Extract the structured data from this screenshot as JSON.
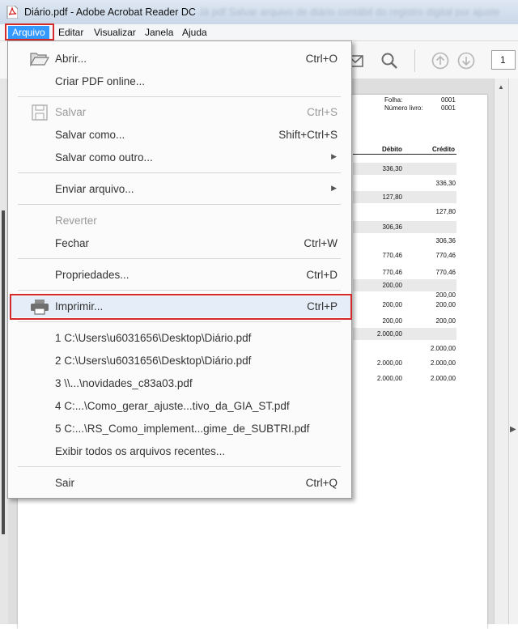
{
  "window": {
    "title": "Diário.pdf - Adobe Acrobat Reader DC",
    "ghost_title": "Já pdf Salvar arquivo de diário contábil do registro digital por ajuste"
  },
  "menubar": {
    "items": [
      {
        "label": "Arquivo",
        "active": true
      },
      {
        "label": "Editar"
      },
      {
        "label": "Visualizar"
      },
      {
        "label": "Janela"
      },
      {
        "label": "Ajuda"
      }
    ]
  },
  "toolbar": {
    "page_number": "1",
    "icons": [
      "mail-icon",
      "search-icon",
      "page-up-icon",
      "page-down-icon"
    ]
  },
  "file_menu": {
    "items": [
      {
        "key": "abrir",
        "label": "Abrir...",
        "shortcut": "Ctrl+O",
        "icon": "folder-open-icon",
        "enabled": true
      },
      {
        "key": "criar",
        "label": "Criar PDF online...",
        "shortcut": "",
        "enabled": true
      },
      {
        "key": "salvar",
        "label": "Salvar",
        "shortcut": "Ctrl+S",
        "icon": "save-icon",
        "enabled": false
      },
      {
        "key": "salvar_como",
        "label": "Salvar como...",
        "shortcut": "Shift+Ctrl+S",
        "enabled": true
      },
      {
        "key": "salvar_outro",
        "label": "Salvar como outro...",
        "shortcut": "",
        "submenu": true,
        "enabled": true
      },
      {
        "key": "enviar",
        "label": "Enviar arquivo...",
        "shortcut": "",
        "submenu": true,
        "enabled": true
      },
      {
        "key": "reverter",
        "label": "Reverter",
        "shortcut": "",
        "enabled": false
      },
      {
        "key": "fechar",
        "label": "Fechar",
        "shortcut": "Ctrl+W",
        "enabled": true
      },
      {
        "key": "propriedades",
        "label": "Propriedades...",
        "shortcut": "Ctrl+D",
        "enabled": true
      },
      {
        "key": "imprimir",
        "label": "Imprimir...",
        "shortcut": "Ctrl+P",
        "icon": "printer-icon",
        "enabled": true,
        "highlighted": true
      },
      {
        "key": "recent1",
        "label": "1 C:\\Users\\u6031656\\Desktop\\Diário.pdf"
      },
      {
        "key": "recent2",
        "label": "2 C:\\Users\\u6031656\\Desktop\\Diário.pdf"
      },
      {
        "key": "recent3",
        "label": "3 \\\\...\\novidades_c83a03.pdf"
      },
      {
        "key": "recent4",
        "label": "4 C:...\\Como_gerar_ajuste...tivo_da_GIA_ST.pdf"
      },
      {
        "key": "recent5",
        "label": "5 C:...\\RS_Como_implement...gime_de_SUBTRI.pdf"
      },
      {
        "key": "exibir",
        "label": "Exibir todos os arquivos recentes..."
      },
      {
        "key": "sair",
        "label": "Sair",
        "shortcut": "Ctrl+Q",
        "enabled": true
      }
    ]
  },
  "document": {
    "folha_label": "Folha:",
    "folha_value": "0001",
    "livro_label": "Número livro:",
    "livro_value": "0001",
    "col_debito": "Débito",
    "col_credito": "Crédito",
    "rows": [
      {
        "debito": "336,30",
        "credito": "",
        "shade": true
      },
      {
        "debito": "",
        "credito": "336,30",
        "shade": false
      },
      {
        "debito": "127,80",
        "credito": "",
        "shade": true
      },
      {
        "debito": "",
        "credito": "127,80",
        "shade": false
      },
      {
        "debito": "306,36",
        "credito": "",
        "shade": true
      },
      {
        "debito": "",
        "credito": "306,36",
        "shade": false
      },
      {
        "debito": "770,46",
        "credito": "770,46",
        "shade": false
      },
      {
        "debito": "770,46",
        "credito": "770,46",
        "shade": false
      },
      {
        "debito": "200,00",
        "credito": "",
        "shade": true
      },
      {
        "debito": "",
        "credito": "200,00",
        "shade": false
      },
      {
        "debito": "200,00",
        "credito": "200,00",
        "shade": false
      },
      {
        "debito": "200,00",
        "credito": "200,00",
        "shade": false
      },
      {
        "debito": "2.000,00",
        "credito": "",
        "shade": true
      },
      {
        "debito": "",
        "credito": "2.000,00",
        "shade": false
      },
      {
        "debito": "2.000,00",
        "credito": "2.000,00",
        "shade": false
      },
      {
        "debito": "2.000,00",
        "credito": "2.000,00",
        "shade": false
      }
    ]
  },
  "colors": {
    "menu_highlight": "#3399ff",
    "callout_red": "#d42a2a",
    "hover_bg": "#e5eef8"
  }
}
